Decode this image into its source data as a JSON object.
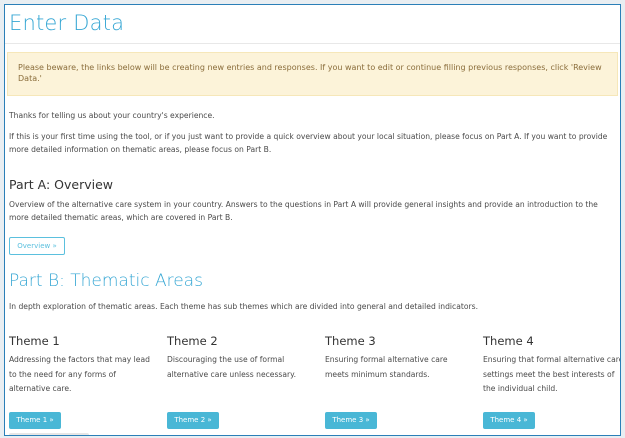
{
  "page": {
    "title": "Enter Data",
    "alert": "Please beware, the links below will be creating new entries and responses. If you want to edit or continue filling previous responses, click 'Review Data.'",
    "intro_1": "Thanks for telling us about your country's experience.",
    "intro_2": "If this is your first time using the tool, or if you just want to provide a quick overview about your local situation, please focus on Part A. If you want to provide more detailed information on thematic areas, please focus on Part B."
  },
  "part_a": {
    "heading": "Part A: Overview",
    "text": "Overview of the alternative care system in your country. Answers to the questions in Part A will provide general insights and provide an introduction to the more detailed thematic areas, which are covered in Part B.",
    "button": "Overview »"
  },
  "part_b": {
    "heading": "Part B: Thematic Areas",
    "text": "In depth exploration of thematic areas. Each theme has sub themes which are divided into general and detailed indicators.",
    "themes": [
      {
        "title": "Theme 1",
        "desc": "Addressing the factors that may lead to the need for any forms of alternative care.",
        "button": "Theme 1 »"
      },
      {
        "title": "Theme 2",
        "desc": "Discouraging the use of formal alternative care unless necessary.",
        "button": "Theme 2 »"
      },
      {
        "title": "Theme 3",
        "desc": "Ensuring formal alternative care meets minimum standards.",
        "button": "Theme 3 »"
      },
      {
        "title": "Theme 4",
        "desc": "Ensuring that formal alternative care settings meet the best interests of the individual child.",
        "button": "Theme 4 »"
      }
    ]
  },
  "colors": {
    "accent": "#37a7d4",
    "button": "#49b7d6",
    "alert_bg": "#fcf3d9",
    "alert_text": "#8a6d3b"
  }
}
